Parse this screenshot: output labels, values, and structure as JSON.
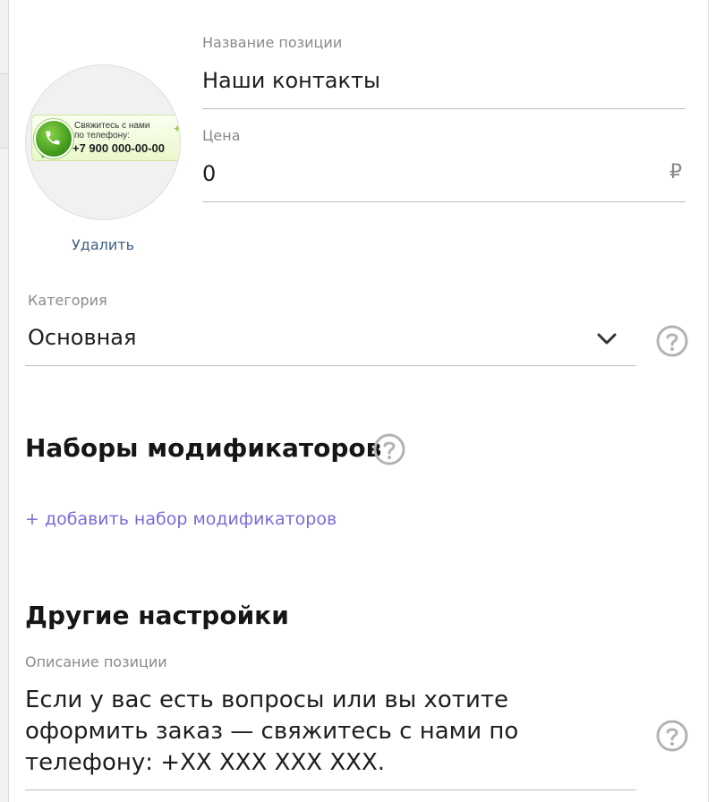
{
  "item": {
    "name_label": "Название позиции",
    "name_value": "Наши контакты",
    "price_label": "Цена",
    "price_value": "0",
    "currency": "₽",
    "delete_label": "Удалить"
  },
  "image_banner": {
    "line1": "Свяжитесь с нами",
    "line2": "по телефону:",
    "phone": "+7 900 000-00-00"
  },
  "category": {
    "label": "Категория",
    "selected": "Основная"
  },
  "modifiers": {
    "title": "Наборы модификаторов",
    "add_link": "+ добавить набор модификаторов"
  },
  "other": {
    "title": "Другие настройки",
    "description_label": "Описание позиции",
    "description_value": "Если у вас есть вопросы или вы хотите оформить заказ — свяжитесь с нами по телефону: +XX XXX XXX XXX."
  },
  "colors": {
    "accent_link": "#7c6ad9",
    "delete_link": "#3f5f80",
    "help_icon": "#b3b3b3"
  },
  "icons": [
    "chevron-down-icon",
    "help-icon",
    "phone-icon"
  ]
}
